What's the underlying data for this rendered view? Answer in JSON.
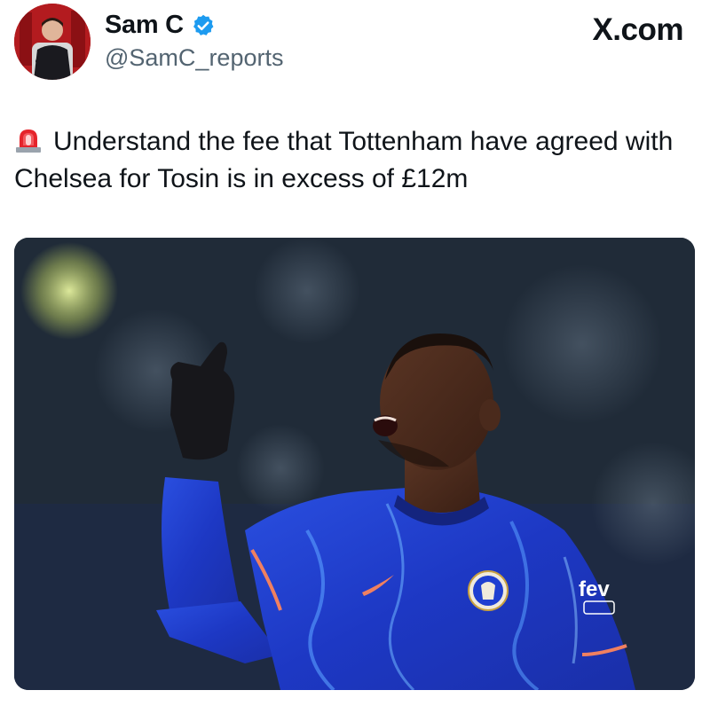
{
  "post": {
    "author_name": "Sam C",
    "handle": "@SamC_reports",
    "brand": "X.com",
    "text": "Understand the fee that Tottenham have agreed with Chelsea for Tosin is in excess of £12m"
  },
  "icons": {
    "verified": "verified-badge-icon",
    "siren": "rotating-light-emoji"
  },
  "colors": {
    "verified_blue": "#1d9bf0",
    "handle_gray": "#536471",
    "kit_blue": "#1f3fd1"
  },
  "media": {
    "shirt_sponsor": "fev"
  }
}
